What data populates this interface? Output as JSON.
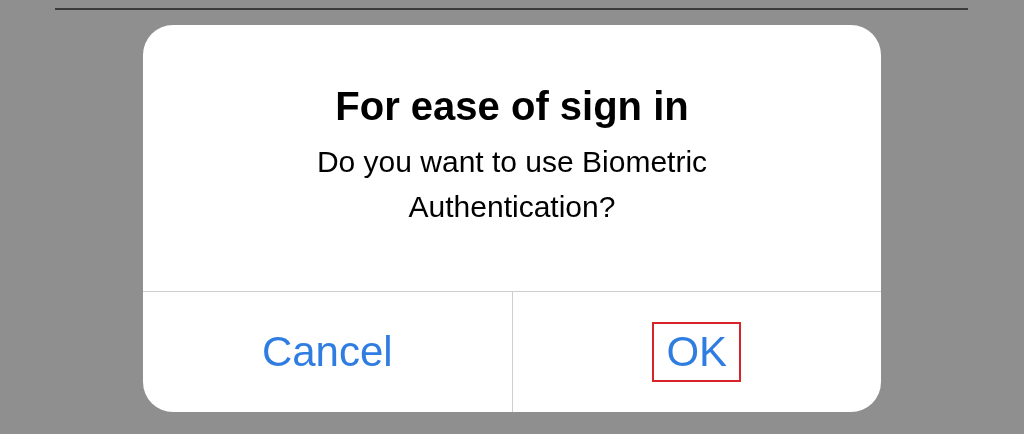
{
  "dialog": {
    "title": "For ease of sign in",
    "message": "Do you want to use Biometric Authentication?",
    "buttons": [
      {
        "label": "Cancel",
        "highlighted": false
      },
      {
        "label": "OK",
        "highlighted": true
      }
    ]
  }
}
